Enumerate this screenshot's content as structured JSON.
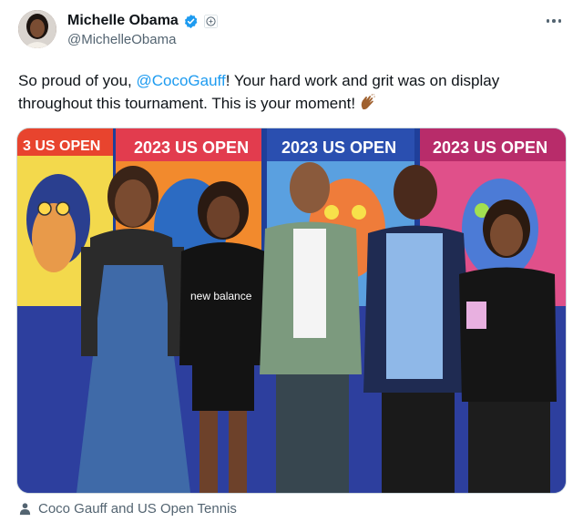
{
  "author": {
    "display_name": "Michelle Obama",
    "handle": "@MichelleObama",
    "verified": true,
    "avatar_icon": "avatar"
  },
  "post": {
    "text_before_mention": "So proud of you, ",
    "mention": "@CocoGauff",
    "text_after_mention": "! Your hard work and grit was on display throughout this tournament. This is your moment!",
    "emoji": "clapping-hands-icon"
  },
  "media": {
    "description_text": {
      "banner_1": "3 US OPEN",
      "banner_2": "2023 US OPEN",
      "banner_3": "2023 US OPEN",
      "banner_4": "2023 US OPEN",
      "shirt_brand": "new balance"
    }
  },
  "tags": {
    "label": "Coco Gauff and US Open Tennis"
  },
  "colors": {
    "mention": "#1d9bf0",
    "secondary_text": "#536471",
    "verified": "#1d9bf0"
  }
}
